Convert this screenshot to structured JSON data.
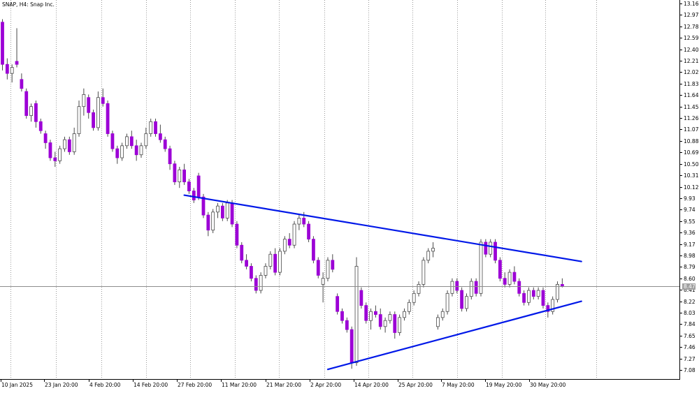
{
  "colors": {
    "background": "#ffffff",
    "grid": "#9a9a9a",
    "axis": "#000000",
    "bull_body": "#ffffff",
    "bull_border": "#4a4a4a",
    "bear_body": "#9c00d6",
    "wick": "#4a4a4a",
    "trendline": "#0018e8",
    "price_line": "#8c8c8c",
    "price_tag": "#a0a0a0"
  },
  "chart_data": {
    "type": "candlestick",
    "title": "SNAP, H4:  Snap Inc.",
    "y_axis": {
      "ylim": [
        7.0,
        13.2
      ],
      "tick_labels": [
        "13.16",
        "12.97",
        "12.78",
        "12.59",
        "12.40",
        "12.21",
        "12.02",
        "11.83",
        "11.64",
        "11.45",
        "11.26",
        "11.07",
        "10.88",
        "10.69",
        "10.50",
        "10.31",
        "10.12",
        "9.93",
        "9.74",
        "9.55",
        "9.36",
        "9.17",
        "8.98",
        "8.79",
        "8.60",
        "8.41",
        "8.22",
        "8.03",
        "7.84",
        "7.65",
        "7.46",
        "7.27",
        "7.08"
      ],
      "side": "right"
    },
    "x_axis": {
      "tick_labels": [
        "10 Jan 2025",
        "23 Jan 20:00",
        "4 Feb 20:00",
        "14 Feb 20:00",
        "27 Feb 20:00",
        "11 Mar 20:00",
        "21 Mar 20:00",
        "2 Apr 20:00",
        "14 Apr 20:00",
        "25 Apr 20:00",
        "7 May 20:00",
        "19 May 20:00",
        "30 May 20:00"
      ],
      "bars_visible": 113,
      "bars_total_space": 141
    },
    "current_price": {
      "value": 8.47,
      "label": "8.47"
    },
    "grid": "vertical-dotted",
    "trendlines": [
      {
        "name": "upper",
        "bar_start": 38,
        "price_start": 9.98,
        "bar_end": 121,
        "price_end": 8.88
      },
      {
        "name": "lower",
        "bar_start": 68,
        "price_start": 7.09,
        "bar_end": 121,
        "price_end": 8.22
      }
    ],
    "candles": [
      [
        12.85,
        12.9,
        12.05,
        12.15
      ],
      [
        12.15,
        12.25,
        11.9,
        12.0
      ],
      [
        12.0,
        12.15,
        11.85,
        12.1
      ],
      [
        12.2,
        12.75,
        12.1,
        12.15
      ],
      [
        11.9,
        12.0,
        11.7,
        11.75
      ],
      [
        11.7,
        11.75,
        11.25,
        11.3
      ],
      [
        11.3,
        11.5,
        11.2,
        11.45
      ],
      [
        11.5,
        11.55,
        11.1,
        11.2
      ],
      [
        11.2,
        11.25,
        11.0,
        11.05
      ],
      [
        11.0,
        11.05,
        10.75,
        10.85
      ],
      [
        10.85,
        10.9,
        10.55,
        10.6
      ],
      [
        10.6,
        10.7,
        10.45,
        10.55
      ],
      [
        10.55,
        10.8,
        10.5,
        10.75
      ],
      [
        10.75,
        10.95,
        10.7,
        10.9
      ],
      [
        10.9,
        10.95,
        10.65,
        10.7
      ],
      [
        10.7,
        11.1,
        10.65,
        11.0
      ],
      [
        11.0,
        11.55,
        10.95,
        11.45
      ],
      [
        11.45,
        11.75,
        11.3,
        11.65
      ],
      [
        11.6,
        11.65,
        11.25,
        11.35
      ],
      [
        11.35,
        11.4,
        11.05,
        11.1
      ],
      [
        11.1,
        11.7,
        11.05,
        11.6
      ],
      [
        11.6,
        11.75,
        11.45,
        11.5
      ],
      [
        11.5,
        11.55,
        10.95,
        11.0
      ],
      [
        11.0,
        11.05,
        10.7,
        10.75
      ],
      [
        10.75,
        10.8,
        10.5,
        10.6
      ],
      [
        10.6,
        10.85,
        10.55,
        10.8
      ],
      [
        10.8,
        11.0,
        10.75,
        10.95
      ],
      [
        10.95,
        11.05,
        10.75,
        10.8
      ],
      [
        10.8,
        10.9,
        10.55,
        10.65
      ],
      [
        10.65,
        10.85,
        10.6,
        10.8
      ],
      [
        10.8,
        11.1,
        10.75,
        11.0
      ],
      [
        11.0,
        11.25,
        10.95,
        11.2
      ],
      [
        11.2,
        11.25,
        10.95,
        11.0
      ],
      [
        11.0,
        11.15,
        10.85,
        10.9
      ],
      [
        10.9,
        10.95,
        10.7,
        10.75
      ],
      [
        10.75,
        10.8,
        10.4,
        10.5
      ],
      [
        10.5,
        10.55,
        10.15,
        10.2
      ],
      [
        10.2,
        10.45,
        10.1,
        10.4
      ],
      [
        10.4,
        10.5,
        10.15,
        10.2
      ],
      [
        10.2,
        10.25,
        10.0,
        10.05
      ],
      [
        10.05,
        10.1,
        9.85,
        9.9
      ],
      [
        10.3,
        10.35,
        9.9,
        9.95
      ],
      [
        9.95,
        10.0,
        9.6,
        9.65
      ],
      [
        9.65,
        9.7,
        9.3,
        9.4
      ],
      [
        9.4,
        9.75,
        9.35,
        9.7
      ],
      [
        9.7,
        9.85,
        9.6,
        9.8
      ],
      [
        9.8,
        9.85,
        9.55,
        9.6
      ],
      [
        9.6,
        9.9,
        9.55,
        9.85
      ],
      [
        9.85,
        9.9,
        9.45,
        9.5
      ],
      [
        9.5,
        9.55,
        9.1,
        9.15
      ],
      [
        9.15,
        9.2,
        8.85,
        8.9
      ],
      [
        8.9,
        9.0,
        8.75,
        8.8
      ],
      [
        8.8,
        8.85,
        8.55,
        8.6
      ],
      [
        8.6,
        8.65,
        8.35,
        8.4
      ],
      [
        8.4,
        8.7,
        8.35,
        8.65
      ],
      [
        8.65,
        8.85,
        8.6,
        8.8
      ],
      [
        8.8,
        9.05,
        8.75,
        9.0
      ],
      [
        9.0,
        9.1,
        8.65,
        8.7
      ],
      [
        8.7,
        9.1,
        8.65,
        9.05
      ],
      [
        9.05,
        9.3,
        9.0,
        9.25
      ],
      [
        9.25,
        9.35,
        9.1,
        9.15
      ],
      [
        9.15,
        9.55,
        9.1,
        9.5
      ],
      [
        9.5,
        9.65,
        9.4,
        9.6
      ],
      [
        9.6,
        9.7,
        9.45,
        9.5
      ],
      [
        9.5,
        9.55,
        9.2,
        9.25
      ],
      [
        9.25,
        9.3,
        8.85,
        8.9
      ],
      [
        8.9,
        8.95,
        8.6,
        8.65
      ],
      [
        8.5,
        8.7,
        8.2,
        8.6
      ],
      [
        8.6,
        8.95,
        8.55,
        8.9
      ],
      [
        8.9,
        9.0,
        8.7,
        8.75
      ],
      [
        8.3,
        8.35,
        8.0,
        8.05
      ],
      [
        8.05,
        8.1,
        7.85,
        7.9
      ],
      [
        7.9,
        7.95,
        7.7,
        7.75
      ],
      [
        7.75,
        7.8,
        7.1,
        7.2
      ],
      [
        7.2,
        8.95,
        7.15,
        8.8
      ],
      [
        8.4,
        8.45,
        8.1,
        8.15
      ],
      [
        8.15,
        8.2,
        7.85,
        7.9
      ],
      [
        7.9,
        8.1,
        7.75,
        8.05
      ],
      [
        8.05,
        8.15,
        7.95,
        8.0
      ],
      [
        8.0,
        8.1,
        7.75,
        7.8
      ],
      [
        7.8,
        7.95,
        7.7,
        7.9
      ],
      [
        7.9,
        8.05,
        7.85,
        8.0
      ],
      [
        8.0,
        8.05,
        7.6,
        7.7
      ],
      [
        7.7,
        8.0,
        7.65,
        7.95
      ],
      [
        7.95,
        8.1,
        7.9,
        8.05
      ],
      [
        8.05,
        8.25,
        8.0,
        8.2
      ],
      [
        8.2,
        8.4,
        8.15,
        8.35
      ],
      [
        8.35,
        8.55,
        8.3,
        8.5
      ],
      [
        8.5,
        8.95,
        8.45,
        8.9
      ],
      [
        8.9,
        9.1,
        8.85,
        9.05
      ],
      [
        9.05,
        9.2,
        8.95,
        9.1
      ],
      [
        7.8,
        8.0,
        7.75,
        7.95
      ],
      [
        7.95,
        8.1,
        7.9,
        8.05
      ],
      [
        8.05,
        8.4,
        8.0,
        8.35
      ],
      [
        8.35,
        8.6,
        8.3,
        8.55
      ],
      [
        8.55,
        8.6,
        8.35,
        8.4
      ],
      [
        8.4,
        8.45,
        8.05,
        8.1
      ],
      [
        8.1,
        8.35,
        8.05,
        8.3
      ],
      [
        8.3,
        8.6,
        8.25,
        8.55
      ],
      [
        8.55,
        8.6,
        8.3,
        8.35
      ],
      [
        8.35,
        9.25,
        8.3,
        9.2
      ],
      [
        9.2,
        9.25,
        8.95,
        9.0
      ],
      [
        9.0,
        9.25,
        8.95,
        9.2
      ],
      [
        9.2,
        9.25,
        8.85,
        8.9
      ],
      [
        8.9,
        8.95,
        8.55,
        8.6
      ],
      [
        8.6,
        8.7,
        8.45,
        8.5
      ],
      [
        8.5,
        8.75,
        8.45,
        8.7
      ],
      [
        8.7,
        8.8,
        8.5,
        8.55
      ],
      [
        8.55,
        8.6,
        8.3,
        8.35
      ],
      [
        8.35,
        8.4,
        8.15,
        8.2
      ],
      [
        8.2,
        8.45,
        8.15,
        8.4
      ],
      [
        8.4,
        8.45,
        8.25,
        8.3
      ],
      [
        8.3,
        8.45,
        8.25,
        8.4
      ],
      [
        8.4,
        8.45,
        8.1,
        8.15
      ],
      [
        8.15,
        8.2,
        7.95,
        8.05
      ],
      [
        8.05,
        8.3,
        8.0,
        8.25
      ],
      [
        8.25,
        8.55,
        8.2,
        8.5
      ],
      [
        8.5,
        8.6,
        8.45,
        8.47
      ]
    ]
  }
}
